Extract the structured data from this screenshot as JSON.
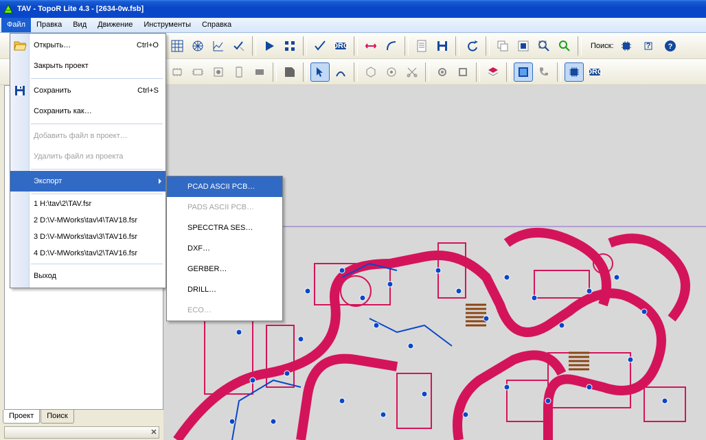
{
  "title": "TAV  -  TopoR Lite 4.3  -  [2634-0w.fsb]",
  "menubar": [
    "Файл",
    "Правка",
    "Вид",
    "Движение",
    "Инструменты",
    "Справка"
  ],
  "search_label": "Поиск:",
  "file_menu": {
    "open": "Открыть…",
    "open_sc": "Ctrl+O",
    "close_proj": "Закрыть проект",
    "save": "Сохранить",
    "save_sc": "Ctrl+S",
    "save_as": "Сохранить как…",
    "add_file": "Добавить файл в проект…",
    "remove_file": "Удалить файл из проекта",
    "export": "Экспорт",
    "recent": [
      "1 H:\\tav\\2\\TAV.fsr",
      "2 D:\\V-MWorks\\tav\\4\\TAV18.fsr",
      "3 D:\\V-MWorks\\tav\\3\\TAV16.fsr",
      "4 D:\\V-MWorks\\tav\\2\\TAV16.fsr"
    ],
    "exit": "Выход"
  },
  "export_menu": {
    "pcad": "PCAD ASCII PCB…",
    "pads": "PADS ASCII PCB…",
    "specctra": "SPECCTRA SES…",
    "dxf": "DXF…",
    "gerber": "GERBER…",
    "drill": "DRILL…",
    "eco": "ECO…"
  },
  "left_tabs": {
    "project": "Проект",
    "search": "Поиск"
  },
  "icons": {
    "open": "folder-open-icon",
    "save": "floppy-icon"
  }
}
